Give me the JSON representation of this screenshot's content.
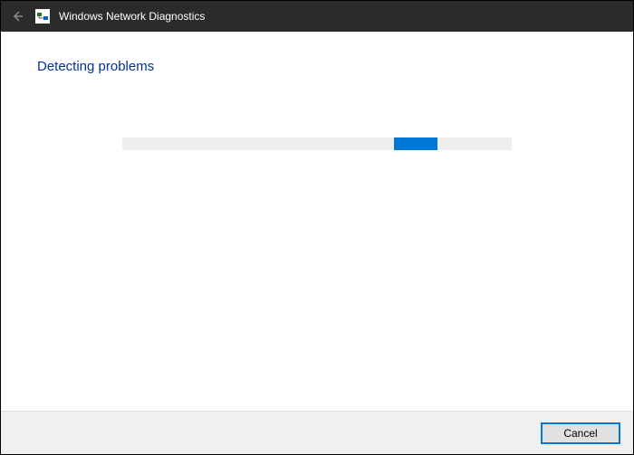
{
  "titlebar": {
    "title": "Windows Network Diagnostics"
  },
  "content": {
    "heading": "Detecting problems"
  },
  "progress": {
    "percent": 70
  },
  "footer": {
    "cancel_label": "Cancel"
  }
}
